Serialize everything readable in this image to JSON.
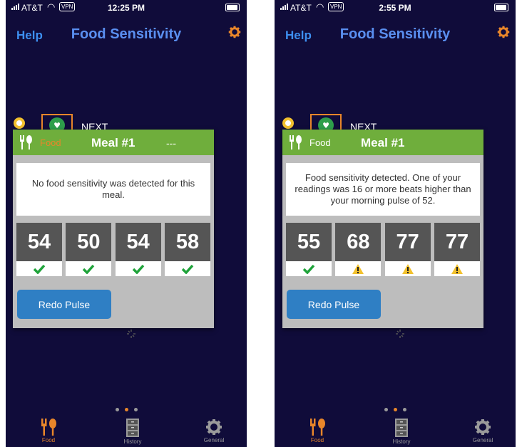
{
  "screens": [
    {
      "status": {
        "carrier": "AT&T",
        "vpn": "VPN",
        "time": "12:25 PM"
      },
      "nav": {
        "help": "Help",
        "title": "Food Sensitivity"
      },
      "next_label": "NEXT",
      "card": {
        "food_label": "Food",
        "meal": "Meal #1",
        "dash": "---",
        "message": "No food sensitivity was detected for this meal.",
        "readings": [
          {
            "value": "54",
            "status": "check"
          },
          {
            "value": "50",
            "status": "check"
          },
          {
            "value": "54",
            "status": "check"
          },
          {
            "value": "58",
            "status": "check"
          }
        ],
        "redo": "Redo Pulse"
      },
      "tabs": [
        "Food",
        "History",
        "General"
      ]
    },
    {
      "status": {
        "carrier": "AT&T",
        "vpn": "VPN",
        "time": "2:55 PM"
      },
      "nav": {
        "help": "Help",
        "title": "Food Sensitivity"
      },
      "next_label": "NEXT",
      "card": {
        "food_label": "Food",
        "meal": "Meal #1",
        "message": "Food sensitivity detected. One of your readings was 16 or more beats higher than your morning pulse of 52.",
        "readings": [
          {
            "value": "55",
            "status": "check"
          },
          {
            "value": "68",
            "status": "warning"
          },
          {
            "value": "77",
            "status": "warning"
          },
          {
            "value": "77",
            "status": "warning"
          }
        ],
        "redo": "Redo Pulse"
      },
      "tabs": [
        "Food",
        "History",
        "General"
      ]
    }
  ],
  "colors": {
    "background": "#100c3a",
    "accent": "#e8862a",
    "header_green": "#6fae3c",
    "button_blue": "#2f7fc4",
    "check_green": "#1fa33a",
    "warning_yellow": "#f2c12e"
  }
}
